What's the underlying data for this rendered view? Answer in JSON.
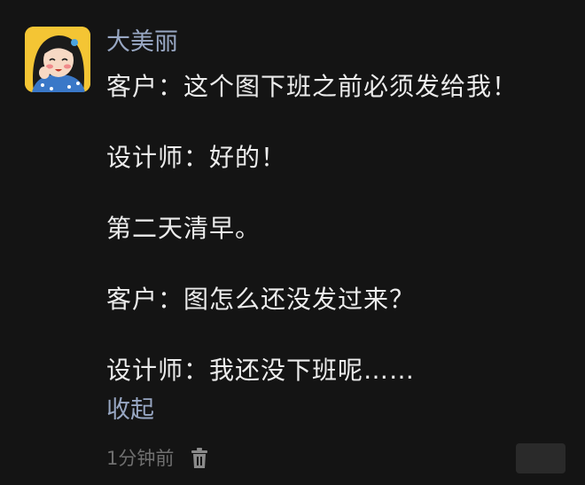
{
  "comment": {
    "username": "大美丽",
    "lines": [
      "客户：这个图下班之前必须发给我！",
      "设计师：好的！",
      "第二天清早。",
      "客户：图怎么还没发过来？",
      "设计师：我还没下班呢……"
    ],
    "collapse_label": "收起",
    "timestamp": "1分钟前"
  },
  "icons": {
    "avatar": "cartoon-girl-avatar",
    "delete": "trash-icon"
  },
  "colors": {
    "background": "#141414",
    "username": "#98a7c3",
    "body_text": "#ececec",
    "link": "#98a7c3",
    "timestamp": "#6f6f6f",
    "avatar_bg": "#f4c534"
  }
}
